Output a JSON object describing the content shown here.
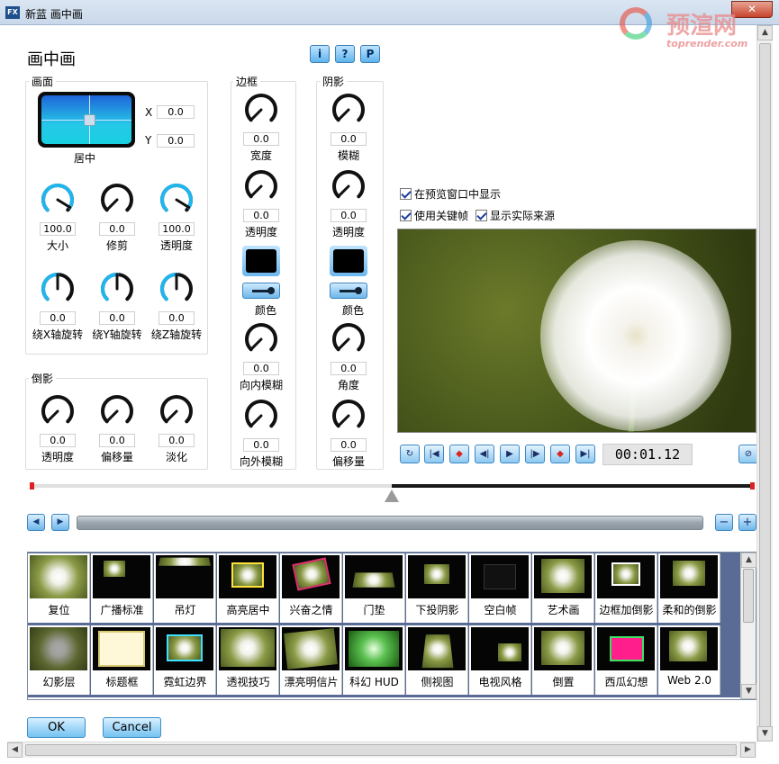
{
  "window": {
    "title": "新蓝 画中画",
    "close": "✕",
    "app_icon": "FX"
  },
  "watermark": {
    "name": "预渲网",
    "url": "toprender.com"
  },
  "heading": "画中画",
  "top_buttons": [
    "i",
    "?",
    "P"
  ],
  "canvas_group": {
    "title": "画面",
    "position_label": "居中",
    "x_label": "X",
    "x_value": "0.0",
    "y_label": "Y",
    "y_value": "0.0",
    "knobs": [
      {
        "label": "大小",
        "value": "100.0"
      },
      {
        "label": "修剪",
        "value": "0.0"
      },
      {
        "label": "透明度",
        "value": "100.0"
      },
      {
        "label": "绕X轴旋转",
        "value": "0.0"
      },
      {
        "label": "绕Y轴旋转",
        "value": "0.0"
      },
      {
        "label": "绕Z轴旋转",
        "value": "0.0"
      }
    ]
  },
  "reflection_group": {
    "title": "倒影",
    "knobs": [
      {
        "label": "透明度",
        "value": "0.0"
      },
      {
        "label": "偏移量",
        "value": "0.0"
      },
      {
        "label": "淡化",
        "value": "0.0"
      }
    ]
  },
  "border_group": {
    "title": "边框",
    "knobs_top": [
      {
        "label": "宽度",
        "value": "0.0"
      },
      {
        "label": "透明度",
        "value": "0.0"
      }
    ],
    "color_label": "颜色",
    "knobs_bottom": [
      {
        "label": "向内模糊",
        "value": "0.0"
      },
      {
        "label": "向外模糊",
        "value": "0.0"
      }
    ]
  },
  "shadow_group": {
    "title": "阴影",
    "knobs_top": [
      {
        "label": "模糊",
        "value": "0.0"
      },
      {
        "label": "透明度",
        "value": "0.0"
      }
    ],
    "color_label": "颜色",
    "knobs_bottom": [
      {
        "label": "角度",
        "value": "0.0"
      },
      {
        "label": "偏移量",
        "value": "0.0"
      }
    ]
  },
  "options": {
    "show_in_preview": "在预览窗口中显示",
    "use_keyframes": "使用关键帧",
    "show_source": "显示实际来源"
  },
  "playback": {
    "timecode": "00:01.12",
    "buttons": [
      "loop",
      "go-start",
      "prev-key",
      "step-back",
      "play",
      "step-forward",
      "next-key",
      "go-end"
    ]
  },
  "timeline": {
    "playhead_fraction": 0.5
  },
  "presets": [
    [
      "复位",
      "广播标准",
      "吊灯",
      "高亮居中",
      "兴奋之情",
      "门垫",
      "下投阴影",
      "空白帧",
      "艺术画",
      "边框加倒影",
      "柔和的倒影"
    ],
    [
      "幻影层",
      "标题框",
      "霓虹边界",
      "透视技巧",
      "漂亮明信片",
      "科幻 HUD",
      "侧视图",
      "电视风格",
      "倒置",
      "西瓜幻想",
      "Web 2.0"
    ]
  ],
  "dialog_buttons": {
    "ok": "OK",
    "cancel": "Cancel"
  }
}
